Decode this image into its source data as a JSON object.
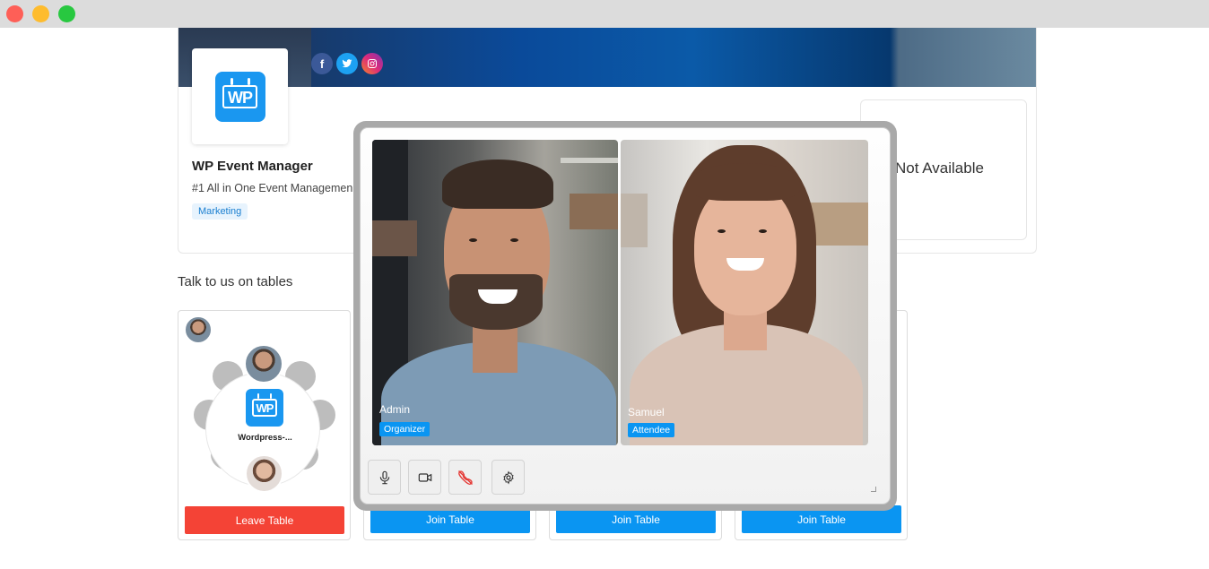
{
  "window": {
    "controls": [
      "close",
      "minimize",
      "maximize"
    ]
  },
  "profile": {
    "logo_text": "WP",
    "name": "WP Event Manager",
    "tagline": "#1 All in One Event Managemen",
    "tag": "Marketing",
    "social": [
      {
        "icon": "facebook-icon",
        "glyph": "f"
      },
      {
        "icon": "twitter-icon",
        "glyph": "t"
      },
      {
        "icon": "instagram-icon",
        "glyph": "◎"
      }
    ],
    "availability": "Not Available"
  },
  "tables_section": {
    "title": "Talk to us on tables",
    "tables": [
      {
        "label": "Wordpress-...",
        "button": "Leave Table",
        "button_type": "leave"
      },
      {
        "button": "Join Table",
        "button_type": "join"
      },
      {
        "button": "Join Table",
        "button_type": "join"
      },
      {
        "button": "Join Table",
        "button_type": "join"
      }
    ]
  },
  "call": {
    "participants": [
      {
        "name": "Admin",
        "role": "Organizer"
      },
      {
        "name": "Samuel",
        "role": "Attendee"
      }
    ],
    "controls": [
      {
        "icon": "microphone-icon"
      },
      {
        "icon": "video-camera-icon"
      },
      {
        "icon": "end-call-icon"
      },
      {
        "icon": "settings-gear-icon"
      }
    ],
    "colors": {
      "accent": "#0a95f2",
      "leave": "#f44336",
      "end_call": "#e53935"
    }
  }
}
